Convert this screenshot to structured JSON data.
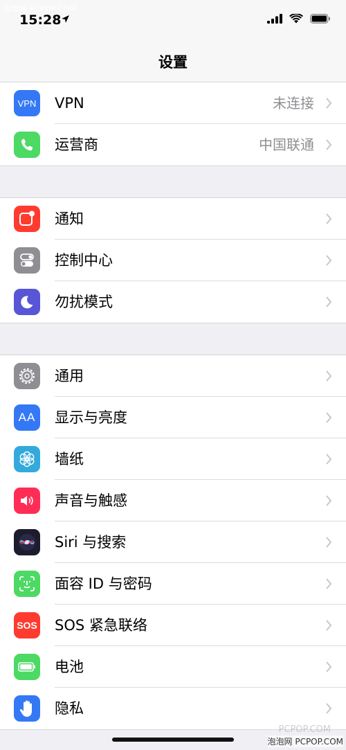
{
  "status_bar": {
    "time": "15:28",
    "watermark": "泡泡网 PCPOP.COM"
  },
  "nav": {
    "title": "设置"
  },
  "groups": [
    {
      "rows": [
        {
          "label": "VPN",
          "value": "未连接",
          "icon": "vpn-icon",
          "color": "#3478f6"
        },
        {
          "label": "运营商",
          "value": "中国联通",
          "icon": "phone-icon",
          "color": "#4cd964"
        }
      ]
    },
    {
      "rows": [
        {
          "label": "通知",
          "icon": "notifications-icon",
          "color": "#ff3b30"
        },
        {
          "label": "控制中心",
          "icon": "control-center-icon",
          "color": "#8e8e93"
        },
        {
          "label": "勿扰模式",
          "icon": "moon-icon",
          "color": "#5856d6"
        }
      ]
    },
    {
      "rows": [
        {
          "label": "通用",
          "icon": "gear-icon",
          "color": "#8e8e93"
        },
        {
          "label": "显示与亮度",
          "icon": "display-icon",
          "color": "#3478f6"
        },
        {
          "label": "墙纸",
          "icon": "wallpaper-icon",
          "color": "#34aadc"
        },
        {
          "label": "声音与触感",
          "icon": "speaker-icon",
          "color": "#ff2d55"
        },
        {
          "label": "Siri 与搜索",
          "icon": "siri-icon",
          "color": "#1c1c2e"
        },
        {
          "label": "面容 ID 与密码",
          "icon": "face-id-icon",
          "color": "#4cd964"
        },
        {
          "label": "SOS 紧急联络",
          "icon": "sos-icon",
          "color": "#ff3b30"
        },
        {
          "label": "电池",
          "icon": "battery-icon",
          "color": "#4cd964"
        },
        {
          "label": "隐私",
          "icon": "hand-icon",
          "color": "#3478f6"
        }
      ]
    }
  ],
  "icon_text": {
    "vpn": "VPN",
    "display": "AA",
    "sos": "SOS"
  },
  "footer": {
    "watermark": "泡泡网 PCPOP.COM",
    "faint_watermark": "PCPOP.COM"
  }
}
